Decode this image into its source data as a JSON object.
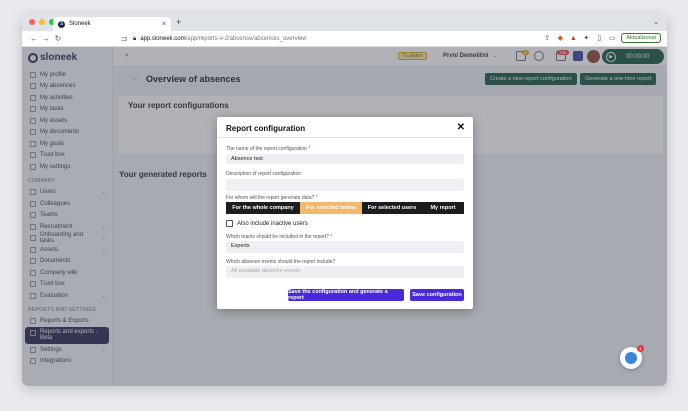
{
  "browser": {
    "tab_title": "Sloneek",
    "tab_favicon": "S",
    "new_tab": "+",
    "url_host": "app.sloneek.com",
    "url_path": "/app/reports-v-2/absence/absences_overview",
    "update_label": "Aktualizovat"
  },
  "app": {
    "logo_text": "sloneek",
    "badge_label": "Tu platen",
    "company_name": "První Demoliční",
    "notif_badge_1": "3",
    "notif_badge_2": "195",
    "timer": "00:00:00"
  },
  "sidebar": {
    "items_personal": [
      {
        "label": "My profile"
      },
      {
        "label": "My absences"
      },
      {
        "label": "My activities"
      },
      {
        "label": "My tasks"
      },
      {
        "label": "My assets"
      },
      {
        "label": "My documents"
      },
      {
        "label": "My goals"
      },
      {
        "label": "Trust box"
      },
      {
        "label": "My settings"
      }
    ],
    "section_company": "COMPANY",
    "items_company": [
      {
        "label": "Users"
      },
      {
        "label": "Colleagues"
      },
      {
        "label": "Teams"
      },
      {
        "label": "Recruitment"
      },
      {
        "label": "Onboarding and tasks"
      },
      {
        "label": "Assets"
      },
      {
        "label": "Documents"
      },
      {
        "label": "Company wiki"
      },
      {
        "label": "Trust box"
      },
      {
        "label": "Evaluation"
      }
    ],
    "section_reports": "REPORTS AND SETTINGS",
    "items_reports": [
      {
        "label": "Reports & Exports"
      },
      {
        "label": "Reports and exports - Beta"
      },
      {
        "label": "Settings"
      },
      {
        "label": "Integrations"
      }
    ]
  },
  "page": {
    "title": "Overview of absences",
    "btn_new_config": "Create a new report configuration",
    "btn_one_time": "Generate a one-time report",
    "your_configs": "Your report configurations",
    "your_generated": "Your generated reports"
  },
  "modal": {
    "title": "Report configuration",
    "name_label": "The name of the report configuration",
    "name_value": "Absence test",
    "desc_label": "Description of report configuration",
    "desc_value": "",
    "whom_label": "For whom will the report generate data?",
    "options": [
      "For the whole company",
      "For selected teams",
      "For selected users",
      "My report"
    ],
    "selected_option": "For selected teams",
    "inactive_label": "Also include inactive users",
    "teams_label": "Which teams should be included in the report?",
    "teams_value": "Experts",
    "events_label": "Which absence events should the report include?",
    "events_placeholder": "All available absence events",
    "btn_save_generate": "Save the configuration and generate a report",
    "btn_save": "Save configuration",
    "required_mark": "*"
  },
  "chat": {
    "badge": "1"
  }
}
